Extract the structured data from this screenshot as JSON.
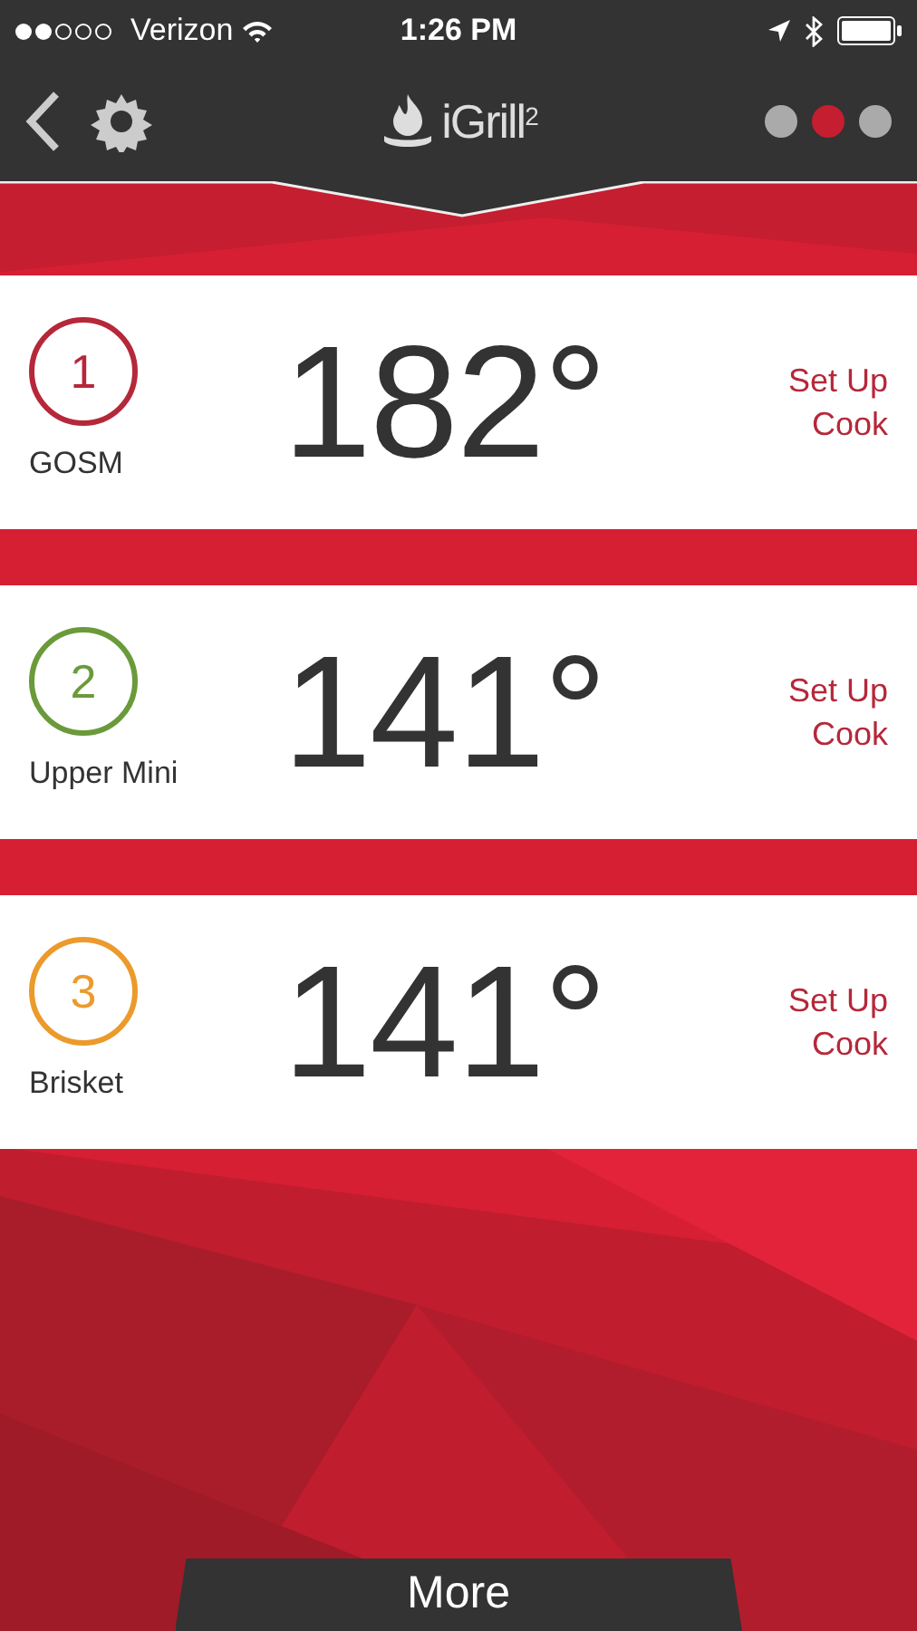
{
  "status_bar": {
    "carrier": "Verizon",
    "time": "1:26 PM"
  },
  "header": {
    "logo_text": "iGrill$^{2}$",
    "pages": [
      {
        "selected": false
      },
      {
        "selected": true
      },
      {
        "selected": false
      }
    ]
  },
  "probes": [
    {
      "number": "1",
      "name": "GOSM",
      "temperature": "182°",
      "action": "Set Up Cook",
      "color": "#b5283a"
    },
    {
      "number": "2",
      "name": "Upper Mini",
      "temperature": "141°",
      "action": "Set Up Cook",
      "color": "#6b9a3a"
    },
    {
      "number": "3",
      "name": "Brisket",
      "temperature": "141°",
      "action": "Set Up Cook",
      "color": "#ec9a2c"
    }
  ],
  "more_button": "More"
}
